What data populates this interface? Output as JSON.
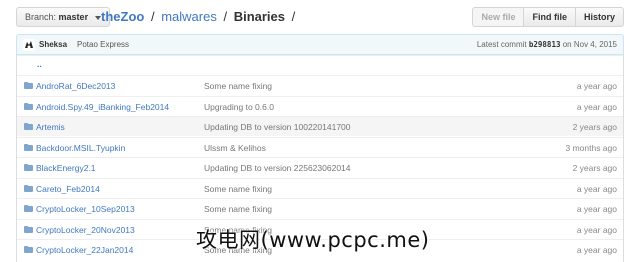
{
  "toolbar": {
    "branch_label": "Branch:",
    "branch_name": "master",
    "repo": "theZoo",
    "sep1": "/",
    "path1": "malwares",
    "sep2": "/",
    "current": "Binaries",
    "sep3": "/",
    "new_file": "New file",
    "find_file": "Find file",
    "history": "History"
  },
  "commit": {
    "author": "Sheksa",
    "message": "Potao Express",
    "latest_label": "Latest commit",
    "sha": "b298813",
    "on_label": "on",
    "date": "Nov 4, 2015"
  },
  "parent_link": "..",
  "files": [
    {
      "name": "AndroRat_6Dec2013",
      "message": "Some name fixing",
      "age": "a year ago"
    },
    {
      "name": "Android.Spy.49_iBanking_Feb2014",
      "message": "Upgrading to 0.6.0",
      "age": "a year ago"
    },
    {
      "name": "Artemis",
      "message": "Updating DB to version 100220141700",
      "age": "2 years ago"
    },
    {
      "name": "Backdoor.MSIL.Tyupkin",
      "message": "Ulssm & Kelihos",
      "age": "3 months ago"
    },
    {
      "name": "BlackEnergy2.1",
      "message": "Updating DB to version 225623062014",
      "age": "2 years ago"
    },
    {
      "name": "Careto_Feb2014",
      "message": "Some name fixing",
      "age": "a year ago"
    },
    {
      "name": "CryptoLocker_10Sep2013",
      "message": "Some name fixing",
      "age": "a year ago"
    },
    {
      "name": "CryptoLocker_20Nov2013",
      "message": "Some name fixing",
      "age": "a year ago"
    },
    {
      "name": "CryptoLocker_22Jan2014",
      "message": "Some name fixing",
      "age": "a year ago"
    }
  ],
  "watermark": "攻电网(www.pcpc.me)",
  "colors": {
    "link": "#4078c0",
    "folder": "#80a6cd",
    "commit_bg": "#f2f8fa"
  }
}
